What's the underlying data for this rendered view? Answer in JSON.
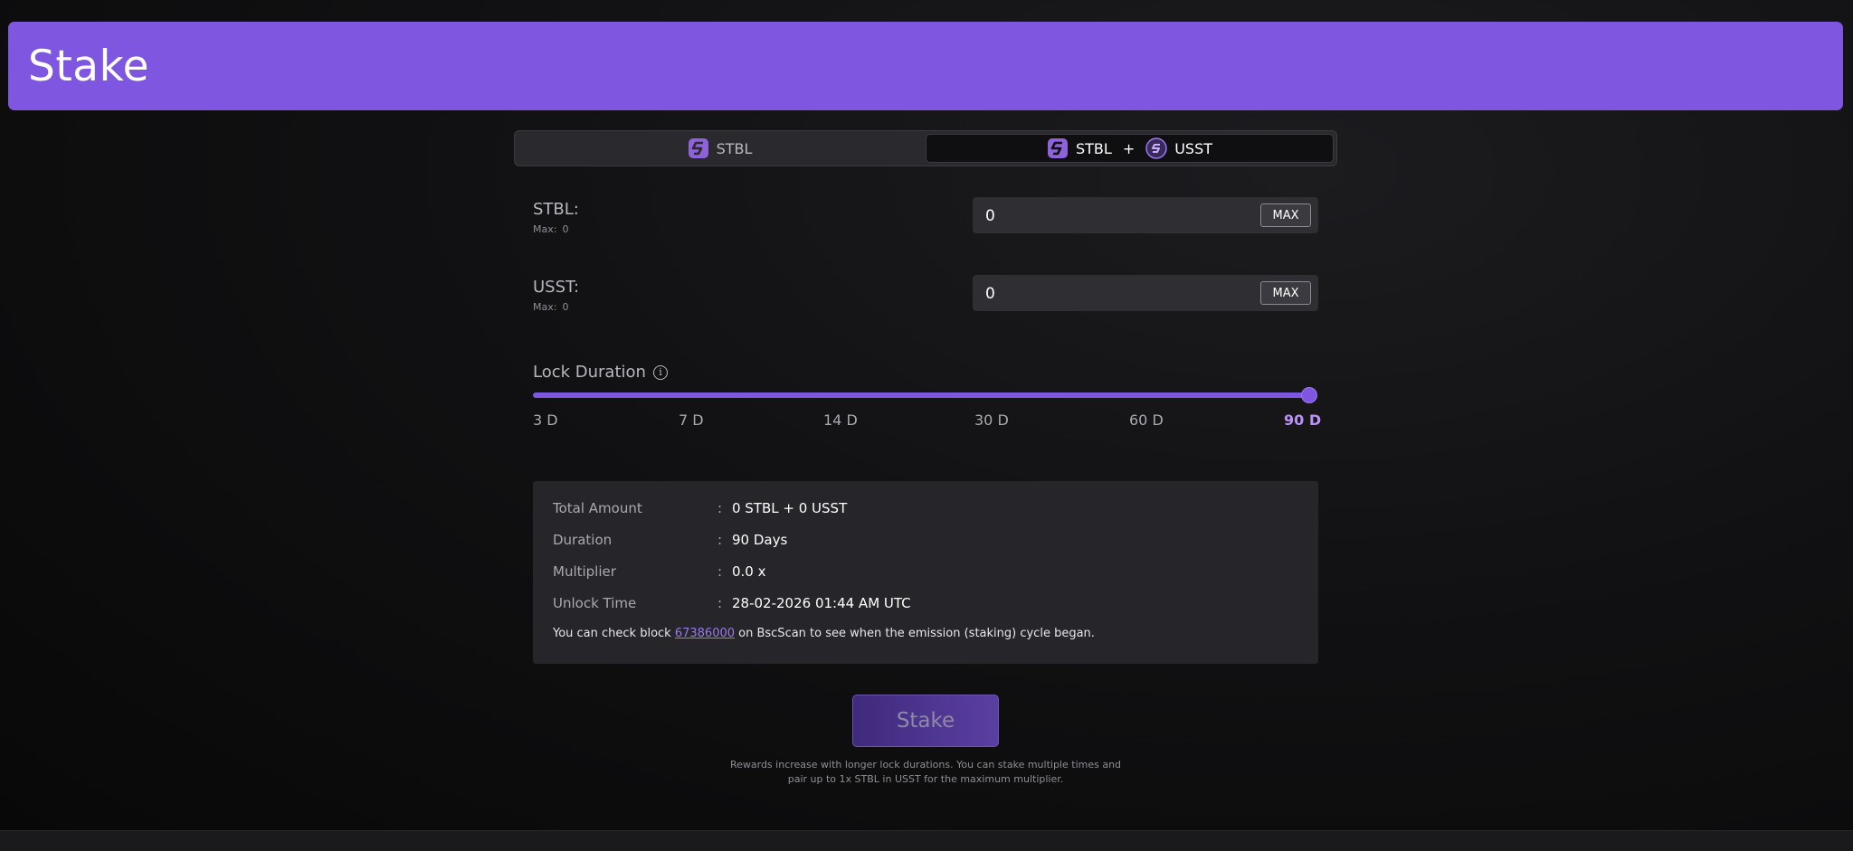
{
  "header": {
    "title": "Stake"
  },
  "tabs": {
    "single": {
      "label": "STBL",
      "icon": "stbl-coin-icon"
    },
    "pair": {
      "label_a": "STBL",
      "plus": "+",
      "label_b": "USST",
      "icon_a": "stbl-coin-icon",
      "icon_b": "usst-coin-icon"
    },
    "active": "pair"
  },
  "stbl_field": {
    "label": "STBL:",
    "max_label": "Max:",
    "max_value": "0",
    "value": "0",
    "max_button": "MAX"
  },
  "usst_field": {
    "label": "USST:",
    "max_label": "Max:",
    "max_value": "0",
    "value": "0",
    "max_button": "MAX"
  },
  "lock": {
    "label": "Lock Duration",
    "info_icon": "info-icon",
    "options": [
      "3 D",
      "7 D",
      "14 D",
      "30 D",
      "60 D",
      "90 D"
    ],
    "selected": "90 D",
    "slider_fraction": 1.0
  },
  "summary": {
    "total_label": "Total Amount",
    "total_value": "0 STBL + 0 USST",
    "duration_label": "Duration",
    "duration_value": "90 Days",
    "multiplier_label": "Multiplier",
    "multiplier_value": "0.0 x",
    "unlock_label": "Unlock Time",
    "unlock_value": "28-02-2026 01:44 AM UTC",
    "colon": ":",
    "note_prefix": "You can check block ",
    "note_block": "67386000",
    "note_suffix": " on BscScan to see when the emission (staking) cycle began."
  },
  "stake_button": "Stake",
  "footnote": {
    "line1": "Rewards increase with longer lock durations. You can stake multiple times and",
    "line2": "pair up to 1x STBL in USST for the maximum multiplier."
  },
  "colors": {
    "accent": "#7e56e0",
    "accent_light": "#b892f5",
    "panel": "#26262a",
    "background": "#0b0b0c"
  }
}
